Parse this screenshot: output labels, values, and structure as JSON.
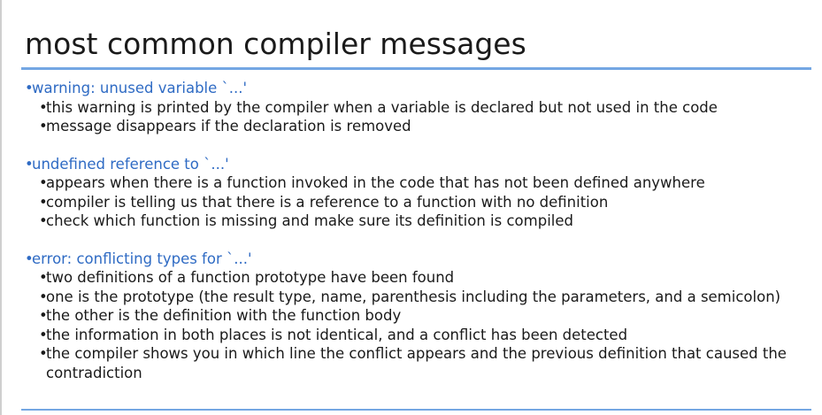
{
  "slide": {
    "title": "most common compiler messages"
  },
  "bullets": [
    {
      "heading": "warning: unused variable `...'",
      "items": [
        "this warning is printed by the compiler when a variable is declared but not used in the code",
        "message disappears if the declaration is removed"
      ]
    },
    {
      "heading": "undefined reference to `...'",
      "items": [
        "appears when there is a function invoked in the code that has not been defined anywhere",
        "compiler is telling us that there is a reference to a function with no definition",
        "check which function is missing and make sure its definition is compiled"
      ]
    },
    {
      "heading": "error: conflicting types for `...'",
      "items": [
        "two definitions of a function prototype have been found",
        "one is the prototype (the result type, name, parenthesis including the parameters, and a semicolon)",
        "the other is the definition with the function body",
        "the information in both places is not identical, and a conflict has been detected",
        "the compiler shows you in which line the conflict appears and the previous definition that caused the contradiction"
      ]
    }
  ],
  "bullet_symbol": "•",
  "colors": {
    "accent": "#2f6bc4",
    "rule": "#74a7e3",
    "text": "#1a1a1a"
  }
}
